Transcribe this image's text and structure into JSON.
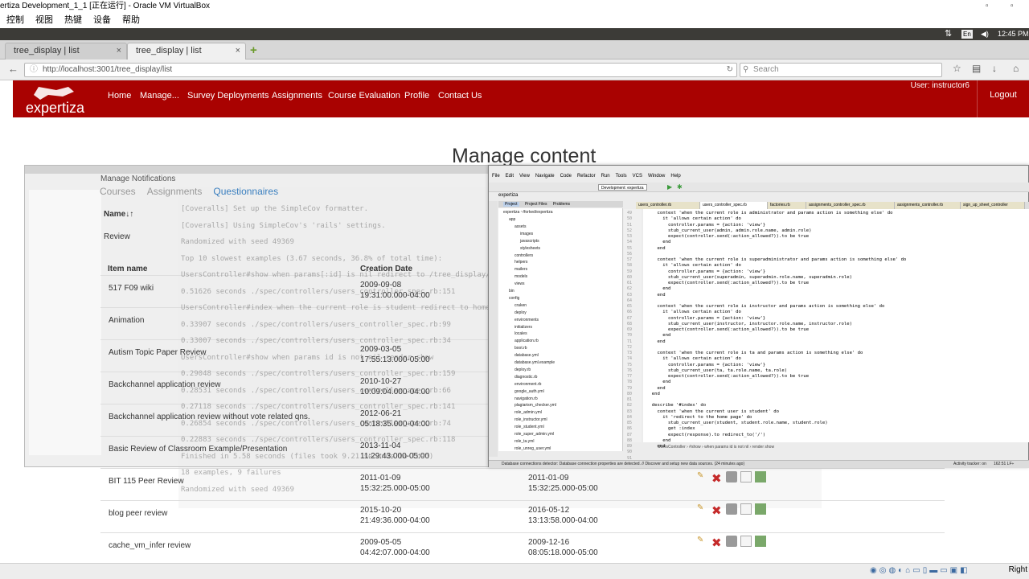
{
  "vbox": {
    "title": "ertiza Development_1_1 [正在运行] - Oracle VM VirtualBox",
    "menu": [
      "控制",
      "视图",
      "热键",
      "设备",
      "帮助"
    ],
    "host_key": "Right"
  },
  "guest": {
    "clock": "12:45 PM",
    "keyboard": "En"
  },
  "browser": {
    "tabs": [
      {
        "label": "tree_display | list",
        "active": false
      },
      {
        "label": "tree_display | list",
        "active": true
      }
    ],
    "url": "http://localhost:3001/tree_display/list",
    "search_placeholder": "Search"
  },
  "site": {
    "logo_text": "expertiza",
    "nav": [
      "Home",
      "Manage...",
      "Survey Deployments",
      "Assignments",
      "Course Evaluation",
      "Profile",
      "Contact Us"
    ],
    "user_label": "User: instructor6",
    "logout": "Logout"
  },
  "page": {
    "title": "Manage content",
    "notifications": "Manage Notifications",
    "subtabs": [
      "Courses",
      "Assignments",
      "Questionnaires"
    ],
    "name_header": "Name↓↑",
    "category": "Review",
    "columns": {
      "item_name": "Item name",
      "creation_date": "Creation Date"
    },
    "rows": [
      {
        "name": "517 F09 wiki",
        "created": "2009-09-08",
        "created_time": "19:31:00.000-04:00",
        "updated": "",
        "updated_time": ""
      },
      {
        "name": "Animation",
        "created": "",
        "created_time": "",
        "updated": "",
        "updated_time": ""
      },
      {
        "name": "Autism Topic Paper Review",
        "created": "2009-03-05",
        "created_time": "17:55:13.000-05:00",
        "updated": "",
        "updated_time": ""
      },
      {
        "name": "Backchannel application review",
        "created": "2010-10-27",
        "created_time": "10:09:04.000-04:00",
        "updated": "",
        "updated_time": ""
      },
      {
        "name": "Backchannel application review without vote related qns.",
        "created": "2012-06-21",
        "created_time": "05:18:35.000-04:00",
        "updated": "",
        "updated_time": ""
      },
      {
        "name": "Basic Review of Classroom Example/Presentation",
        "created": "2013-11-04",
        "created_time": "11:29:43.000-05:00",
        "updated": "",
        "updated_time": ""
      },
      {
        "name": "BIT 115 Peer Review",
        "created": "2011-01-09",
        "created_time": "15:32:25.000-05:00",
        "updated": "2011-01-09",
        "updated_time": "15:32:25.000-05:00"
      },
      {
        "name": "blog peer review",
        "created": "2015-10-20",
        "created_time": "21:49:36.000-04:00",
        "updated": "2016-05-12",
        "updated_time": "13:13:58.000-04:00"
      },
      {
        "name": "cache_vm_infer review",
        "created": "2009-05-05",
        "created_time": "04:42:07.000-04:00",
        "updated": "2009-12-16",
        "updated_time": "08:05:18.000-05:00"
      }
    ]
  },
  "terminal": {
    "lines": [
      "[Coveralls] Set up the SimpleCov formatter.",
      "[Coveralls] Using SimpleCov's 'rails' settings.",
      "Randomized with seed 49369",
      "Top 10 slowest examples (3.67 seconds, 36.8% of total time):",
      "  UsersController#show when params[:id] is nil redirect to /tree_display/drill",
      "    0.51626 seconds ./spec/controllers/users_controller_spec.rb:151",
      "  UsersController#index when the current role is student redirect to home page",
      "    0.33907 seconds ./spec/controllers/users_controller_spec.rb:99",
      "    0.33007 seconds ./spec/controllers/users_controller_spec.rb:34",
      "  UsersController#show when params id is not nil render show",
      "    0.29048 seconds ./spec/controllers/users_controller_spec.rb:159",
      "    0.28531 seconds ./spec/controllers/users_controller_spec.rb:66",
      "    0.27118 seconds ./spec/controllers/users_controller_spec.rb:141",
      "    0.26854 seconds ./spec/controllers/users_controller_spec.rb:74",
      "    0.22883 seconds ./spec/controllers/users_controller_spec.rb:118",
      "Finished in 5.58 seconds (files took 9.21 seconds to load)",
      "18 examples, 9 failures",
      "Randomized with seed 49369"
    ]
  },
  "ide": {
    "menu": [
      "File",
      "Edit",
      "View",
      "Navigate",
      "Code",
      "Refactor",
      "Run",
      "Tools",
      "VCS",
      "Window",
      "Help"
    ],
    "project_label": "expertiza",
    "run_config": "Development: expertiza",
    "panel_tabs": [
      "Project",
      "Project Files",
      "Problems"
    ],
    "root_path": "expertiza ~/forked/expertiza",
    "tree": [
      "app",
      "assets",
      "images",
      "javascripts",
      "stylesheets",
      "controllers",
      "helpers",
      "mailers",
      "models",
      "views",
      "bin",
      "config",
      "craken",
      "deploy",
      "environments",
      "initializers",
      "locales",
      "application.rb",
      "boot.rb",
      "database.yml",
      "database.yml.example",
      "deploy.rb",
      "diagnostic.rb",
      "environment.rb",
      "google_auth.yml",
      "navigation.rb",
      "plagiarism_checker.yml",
      "role_admin.yml",
      "role_instructor.yml",
      "role_student.yml",
      "role_super_admin.yml",
      "role_ta.yml",
      "role_unreg_user.yml"
    ],
    "editor_tabs": [
      "users_controller.rb",
      "users_controller_spec.rb",
      "factories.rb",
      "assignments_controller_spec.rb",
      "assignments_controller.rb",
      "sign_up_sheet_controller"
    ],
    "line_numbers": [
      "49",
      "50",
      "51",
      "52",
      "53",
      "54",
      "55",
      "56",
      "57",
      "58",
      "59",
      "60",
      "61",
      "62",
      "63",
      "64",
      "65",
      "66",
      "67",
      "68",
      "69",
      "70",
      "71",
      "72",
      "73",
      "74",
      "75",
      "76",
      "77",
      "78",
      "79",
      "80",
      "81",
      "82",
      "83",
      "84",
      "85",
      "86",
      "87",
      "88",
      "89",
      "90",
      "91"
    ],
    "code": [
      "    context 'when the current role is administrator and params action is something else' do",
      "      it 'allows certain action' do",
      "        controller.params = {action: 'view'}",
      "        stub_current_user(admin, admin.role.name, admin.role)",
      "        expect(controller.send(:action_allowed?)).to be true",
      "      end",
      "    end",
      "",
      "    context 'when the current role is superadministrator and params action is something else' do",
      "      it 'allows certain action' do",
      "        controller.params = {action: 'view'}",
      "        stub_current_user(superadmin, superadmin.role.name, superadmin.role)",
      "        expect(controller.send(:action_allowed?)).to be true",
      "      end",
      "    end",
      "",
      "    context 'when the current role is instructor and params action is something else' do",
      "      it 'allows certain action' do",
      "        controller.params = {action: 'view'}",
      "        stub_current_user(instructor, instructor.role.name, instructor.role)",
      "        expect(controller.send(:action_allowed?)).to be true",
      "      end",
      "    end",
      "",
      "    context 'when the current role is ta and params action is something else' do",
      "      it 'allows certain action' do",
      "        controller.params = {action: 'view'}",
      "        stub_current_user(ta, ta.role.name, ta.role)",
      "        expect(controller.send(:action_allowed?)).to be true",
      "      end",
      "    end",
      "  end",
      "",
      "  describe '#index' do",
      "    context 'when the current user is student' do",
      "      it 'redirect to the home page' do",
      "        stub_current_user(student, student.role.name, student.role)",
      "        get :index",
      "        expect(response).to redirect_to('/')",
      "      end",
      "    end"
    ],
    "breadcrumb": "UsersController  ›  #show  ›  when params id is not nil  ›  render show",
    "status": "Database connections detector: Database connection properties are detected. // Discover and setup new data sources. (24 minutes ago)",
    "activity": "Activity tracker: on",
    "position": "162:51  LF÷"
  },
  "colors": {
    "brand_red": "#a90201",
    "host_bar": "#3c3b37"
  }
}
